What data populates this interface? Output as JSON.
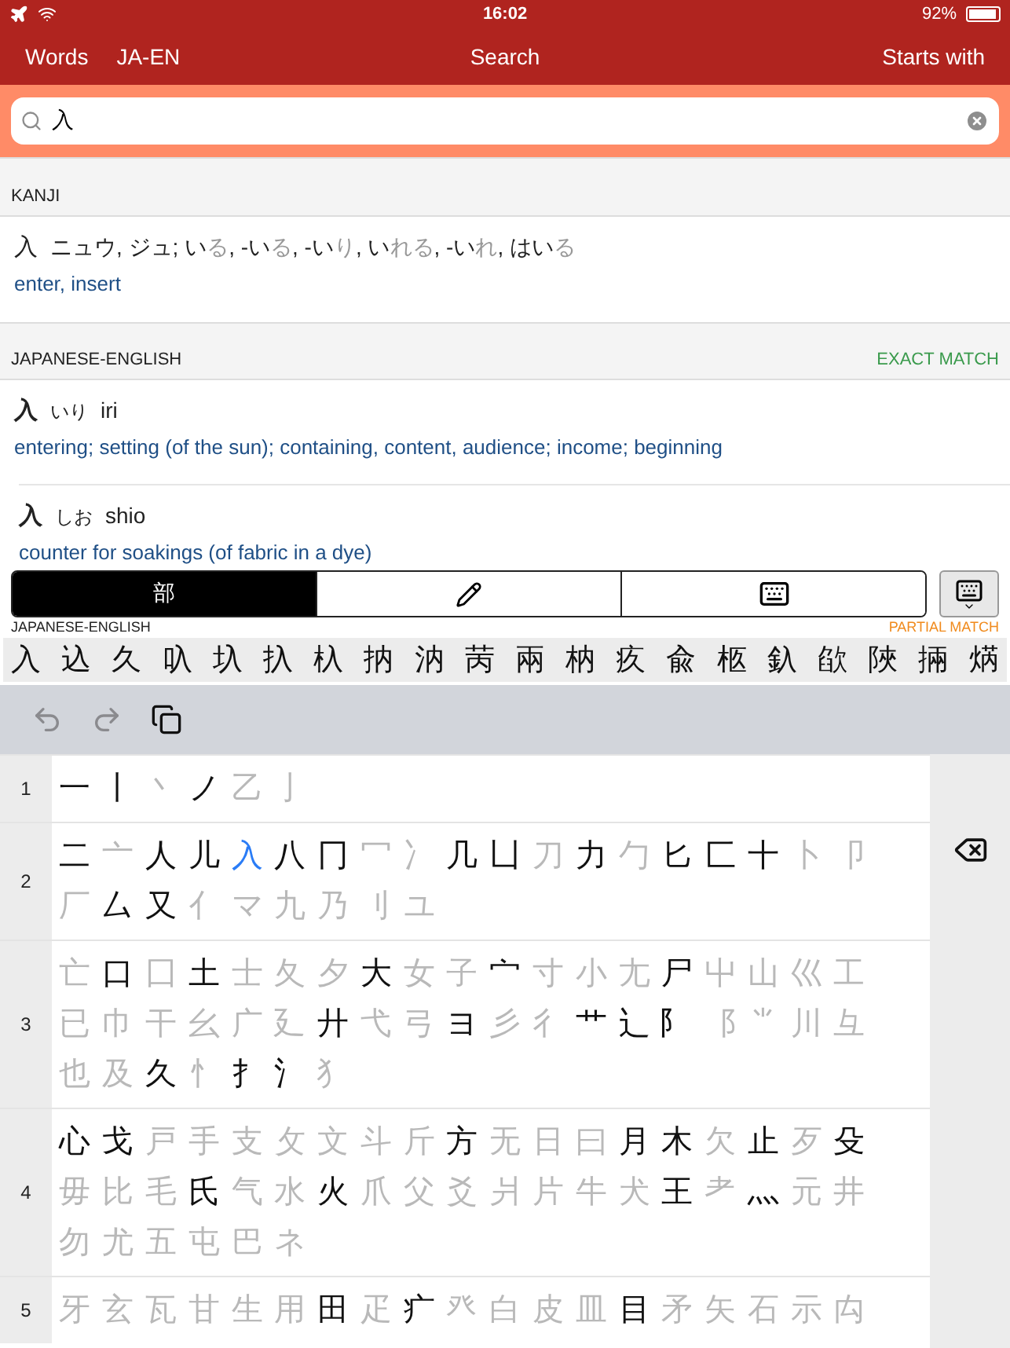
{
  "status_bar": {
    "time": "16:02",
    "battery": "92%"
  },
  "nav": {
    "left": [
      "Words",
      "JA-EN"
    ],
    "title": "Search",
    "right": "Starts with"
  },
  "search": {
    "value": "入"
  },
  "kanji_section": {
    "title": "KANJI",
    "entry": {
      "kanji": "入",
      "readings": [
        {
          "text": "ニュウ, ジュ; い",
          "okurigana": false
        },
        {
          "text": "る",
          "okurigana": true
        },
        {
          "text": ", -い",
          "okurigana": false
        },
        {
          "text": "る",
          "okurigana": true
        },
        {
          "text": ", -い",
          "okurigana": false
        },
        {
          "text": "り",
          "okurigana": true
        },
        {
          "text": ", い",
          "okurigana": false
        },
        {
          "text": "れる",
          "okurigana": true
        },
        {
          "text": ", -い",
          "okurigana": false
        },
        {
          "text": "れ",
          "okurigana": true
        },
        {
          "text": ", はい",
          "okurigana": false
        },
        {
          "text": "る",
          "okurigana": true
        }
      ],
      "meaning": "enter, insert"
    }
  },
  "dictionary_section": {
    "title": "JAPANESE-ENGLISH",
    "match": {
      "kind": "exact",
      "label": "EXACT MATCH"
    },
    "entries": [
      {
        "headword": "入",
        "kana": "いり",
        "romaji": "iri",
        "gloss": "entering; setting (of the sun); containing, content, audience; income; beginning"
      },
      {
        "headword": "入",
        "kana": "しお",
        "romaji": "shio",
        "gloss": "counter for soakings (of fabric in a dye)"
      }
    ]
  },
  "input_modes": [
    {
      "kind": "radical",
      "label": "部",
      "selected": true
    },
    {
      "kind": "handwriting",
      "selected": false
    },
    {
      "kind": "keyboard",
      "selected": false
    }
  ],
  "partial_section": {
    "title": "JAPANESE-ENGLISH",
    "match": {
      "kind": "partial",
      "label": "PARTIAL MATCH"
    }
  },
  "candidates": [
    "入",
    "込",
    "久",
    "叺",
    "圦",
    "扖",
    "杁",
    "抐",
    "汭",
    "苪",
    "兩",
    "枘",
    "疚",
    "兪",
    "柩",
    "釞",
    "欿",
    "陜",
    "掚",
    "焫"
  ],
  "toolbar": [
    {
      "kind": "undo",
      "disabled": true
    },
    {
      "kind": "redo",
      "disabled": true
    },
    {
      "kind": "copy",
      "disabled": false
    }
  ],
  "radical_groups": [
    {
      "strokes": "1",
      "radicals": [
        {
          "char": "一",
          "available": true,
          "selected": false
        },
        {
          "char": "丨",
          "available": true,
          "selected": false
        },
        {
          "char": "丶",
          "available": false,
          "selected": false
        },
        {
          "char": "ノ",
          "available": true,
          "selected": false
        },
        {
          "char": "乙",
          "available": false,
          "selected": false
        },
        {
          "char": "亅",
          "available": false,
          "selected": false
        }
      ]
    },
    {
      "strokes": "2",
      "radicals": [
        {
          "char": "二",
          "available": true,
          "selected": false
        },
        {
          "char": "亠",
          "available": false,
          "selected": false
        },
        {
          "char": "人",
          "available": true,
          "selected": false
        },
        {
          "char": "儿",
          "available": true,
          "selected": false
        },
        {
          "char": "入",
          "available": true,
          "selected": true
        },
        {
          "char": "八",
          "available": true,
          "selected": false
        },
        {
          "char": "冂",
          "available": true,
          "selected": false
        },
        {
          "char": "冖",
          "available": false,
          "selected": false
        },
        {
          "char": "冫",
          "available": false,
          "selected": false
        },
        {
          "char": "几",
          "available": true,
          "selected": false
        },
        {
          "char": "凵",
          "available": true,
          "selected": false
        },
        {
          "char": "刀",
          "available": false,
          "selected": false
        },
        {
          "char": "力",
          "available": true,
          "selected": false
        },
        {
          "char": "勹",
          "available": false,
          "selected": false
        },
        {
          "char": "匕",
          "available": true,
          "selected": false
        },
        {
          "char": "匚",
          "available": true,
          "selected": false
        },
        {
          "char": "十",
          "available": true,
          "selected": false
        },
        {
          "char": "卜",
          "available": false,
          "selected": false
        },
        {
          "char": "卩",
          "available": false,
          "selected": false
        },
        {
          "char": "厂",
          "available": false,
          "selected": false
        },
        {
          "char": "厶",
          "available": true,
          "selected": false
        },
        {
          "char": "又",
          "available": true,
          "selected": false
        },
        {
          "char": "亻",
          "available": false,
          "selected": false
        },
        {
          "char": "マ",
          "available": false,
          "selected": false
        },
        {
          "char": "九",
          "available": false,
          "selected": false
        },
        {
          "char": "乃",
          "available": false,
          "selected": false
        },
        {
          "char": "刂",
          "available": false,
          "selected": false
        },
        {
          "char": "ユ",
          "available": false,
          "selected": false
        }
      ]
    },
    {
      "strokes": "3",
      "radicals": [
        {
          "char": "亡",
          "available": false,
          "selected": false
        },
        {
          "char": "口",
          "available": true,
          "selected": false
        },
        {
          "char": "囗",
          "available": false,
          "selected": false
        },
        {
          "char": "土",
          "available": true,
          "selected": false
        },
        {
          "char": "士",
          "available": false,
          "selected": false
        },
        {
          "char": "夂",
          "available": false,
          "selected": false
        },
        {
          "char": "夕",
          "available": false,
          "selected": false
        },
        {
          "char": "大",
          "available": true,
          "selected": false
        },
        {
          "char": "女",
          "available": false,
          "selected": false
        },
        {
          "char": "子",
          "available": false,
          "selected": false
        },
        {
          "char": "宀",
          "available": true,
          "selected": false
        },
        {
          "char": "寸",
          "available": false,
          "selected": false
        },
        {
          "char": "小",
          "available": false,
          "selected": false
        },
        {
          "char": "尢",
          "available": false,
          "selected": false
        },
        {
          "char": "尸",
          "available": true,
          "selected": false
        },
        {
          "char": "屮",
          "available": false,
          "selected": false
        },
        {
          "char": "山",
          "available": false,
          "selected": false
        },
        {
          "char": "巛",
          "available": false,
          "selected": false
        },
        {
          "char": "工",
          "available": false,
          "selected": false
        },
        {
          "char": "已",
          "available": false,
          "selected": false
        },
        {
          "char": "巾",
          "available": false,
          "selected": false
        },
        {
          "char": "干",
          "available": false,
          "selected": false
        },
        {
          "char": "幺",
          "available": false,
          "selected": false
        },
        {
          "char": "广",
          "available": false,
          "selected": false
        },
        {
          "char": "廴",
          "available": false,
          "selected": false
        },
        {
          "char": "廾",
          "available": true,
          "selected": false
        },
        {
          "char": "弋",
          "available": false,
          "selected": false
        },
        {
          "char": "弓",
          "available": false,
          "selected": false
        },
        {
          "char": "ヨ",
          "available": true,
          "selected": false
        },
        {
          "char": "彡",
          "available": false,
          "selected": false
        },
        {
          "char": "彳",
          "available": false,
          "selected": false
        },
        {
          "char": "⺾",
          "available": true,
          "selected": false
        },
        {
          "char": "⻌",
          "available": true,
          "selected": false
        },
        {
          "char": "⻖",
          "available": true,
          "selected": false
        },
        {
          "char": "⻏",
          "available": false,
          "selected": false
        },
        {
          "char": "⺌",
          "available": false,
          "selected": false
        },
        {
          "char": "川",
          "available": false,
          "selected": false
        },
        {
          "char": "彑",
          "available": false,
          "selected": false
        },
        {
          "char": "也",
          "available": false,
          "selected": false
        },
        {
          "char": "及",
          "available": false,
          "selected": false
        },
        {
          "char": "久",
          "available": true,
          "selected": false
        },
        {
          "char": "忄",
          "available": false,
          "selected": false
        },
        {
          "char": "扌",
          "available": true,
          "selected": false
        },
        {
          "char": "氵",
          "available": true,
          "selected": false
        },
        {
          "char": "犭",
          "available": false,
          "selected": false
        }
      ]
    },
    {
      "strokes": "4",
      "radicals": [
        {
          "char": "心",
          "available": true,
          "selected": false
        },
        {
          "char": "戈",
          "available": true,
          "selected": false
        },
        {
          "char": "戸",
          "available": false,
          "selected": false
        },
        {
          "char": "手",
          "available": false,
          "selected": false
        },
        {
          "char": "支",
          "available": false,
          "selected": false
        },
        {
          "char": "攵",
          "available": false,
          "selected": false
        },
        {
          "char": "文",
          "available": false,
          "selected": false
        },
        {
          "char": "斗",
          "available": false,
          "selected": false
        },
        {
          "char": "斤",
          "available": false,
          "selected": false
        },
        {
          "char": "方",
          "available": true,
          "selected": false
        },
        {
          "char": "无",
          "available": false,
          "selected": false
        },
        {
          "char": "日",
          "available": false,
          "selected": false
        },
        {
          "char": "曰",
          "available": false,
          "selected": false
        },
        {
          "char": "月",
          "available": true,
          "selected": false
        },
        {
          "char": "木",
          "available": true,
          "selected": false
        },
        {
          "char": "欠",
          "available": false,
          "selected": false
        },
        {
          "char": "止",
          "available": true,
          "selected": false
        },
        {
          "char": "歹",
          "available": false,
          "selected": false
        },
        {
          "char": "殳",
          "available": true,
          "selected": false
        },
        {
          "char": "毋",
          "available": false,
          "selected": false
        },
        {
          "char": "比",
          "available": false,
          "selected": false
        },
        {
          "char": "毛",
          "available": false,
          "selected": false
        },
        {
          "char": "氏",
          "available": true,
          "selected": false
        },
        {
          "char": "气",
          "available": false,
          "selected": false
        },
        {
          "char": "水",
          "available": false,
          "selected": false
        },
        {
          "char": "火",
          "available": true,
          "selected": false
        },
        {
          "char": "爪",
          "available": false,
          "selected": false
        },
        {
          "char": "父",
          "available": false,
          "selected": false
        },
        {
          "char": "爻",
          "available": false,
          "selected": false
        },
        {
          "char": "爿",
          "available": false,
          "selected": false
        },
        {
          "char": "片",
          "available": false,
          "selected": false
        },
        {
          "char": "牛",
          "available": false,
          "selected": false
        },
        {
          "char": "犬",
          "available": false,
          "selected": false
        },
        {
          "char": "王",
          "available": true,
          "selected": false
        },
        {
          "char": "耂",
          "available": false,
          "selected": false
        },
        {
          "char": "灬",
          "available": true,
          "selected": false
        },
        {
          "char": "元",
          "available": false,
          "selected": false
        },
        {
          "char": "井",
          "available": false,
          "selected": false
        },
        {
          "char": "勿",
          "available": false,
          "selected": false
        },
        {
          "char": "尤",
          "available": false,
          "selected": false
        },
        {
          "char": "五",
          "available": false,
          "selected": false
        },
        {
          "char": "屯",
          "available": false,
          "selected": false
        },
        {
          "char": "巴",
          "available": false,
          "selected": false
        },
        {
          "char": "ネ",
          "available": false,
          "selected": false
        }
      ]
    },
    {
      "strokes": "5",
      "radicals": [
        {
          "char": "牙",
          "available": false,
          "selected": false
        },
        {
          "char": "玄",
          "available": false,
          "selected": false
        },
        {
          "char": "瓦",
          "available": false,
          "selected": false
        },
        {
          "char": "甘",
          "available": false,
          "selected": false
        },
        {
          "char": "生",
          "available": false,
          "selected": false
        },
        {
          "char": "用",
          "available": false,
          "selected": false
        },
        {
          "char": "田",
          "available": true,
          "selected": false
        },
        {
          "char": "疋",
          "available": false,
          "selected": false
        },
        {
          "char": "疒",
          "available": true,
          "selected": false
        },
        {
          "char": "癶",
          "available": false,
          "selected": false
        },
        {
          "char": "白",
          "available": false,
          "selected": false
        },
        {
          "char": "皮",
          "available": false,
          "selected": false
        },
        {
          "char": "皿",
          "available": false,
          "selected": false
        },
        {
          "char": "目",
          "available": true,
          "selected": false
        },
        {
          "char": "矛",
          "available": false,
          "selected": false
        },
        {
          "char": "矢",
          "available": false,
          "selected": false
        },
        {
          "char": "石",
          "available": false,
          "selected": false
        },
        {
          "char": "示",
          "available": false,
          "selected": false
        },
        {
          "char": "禸",
          "available": false,
          "selected": false
        }
      ]
    }
  ]
}
